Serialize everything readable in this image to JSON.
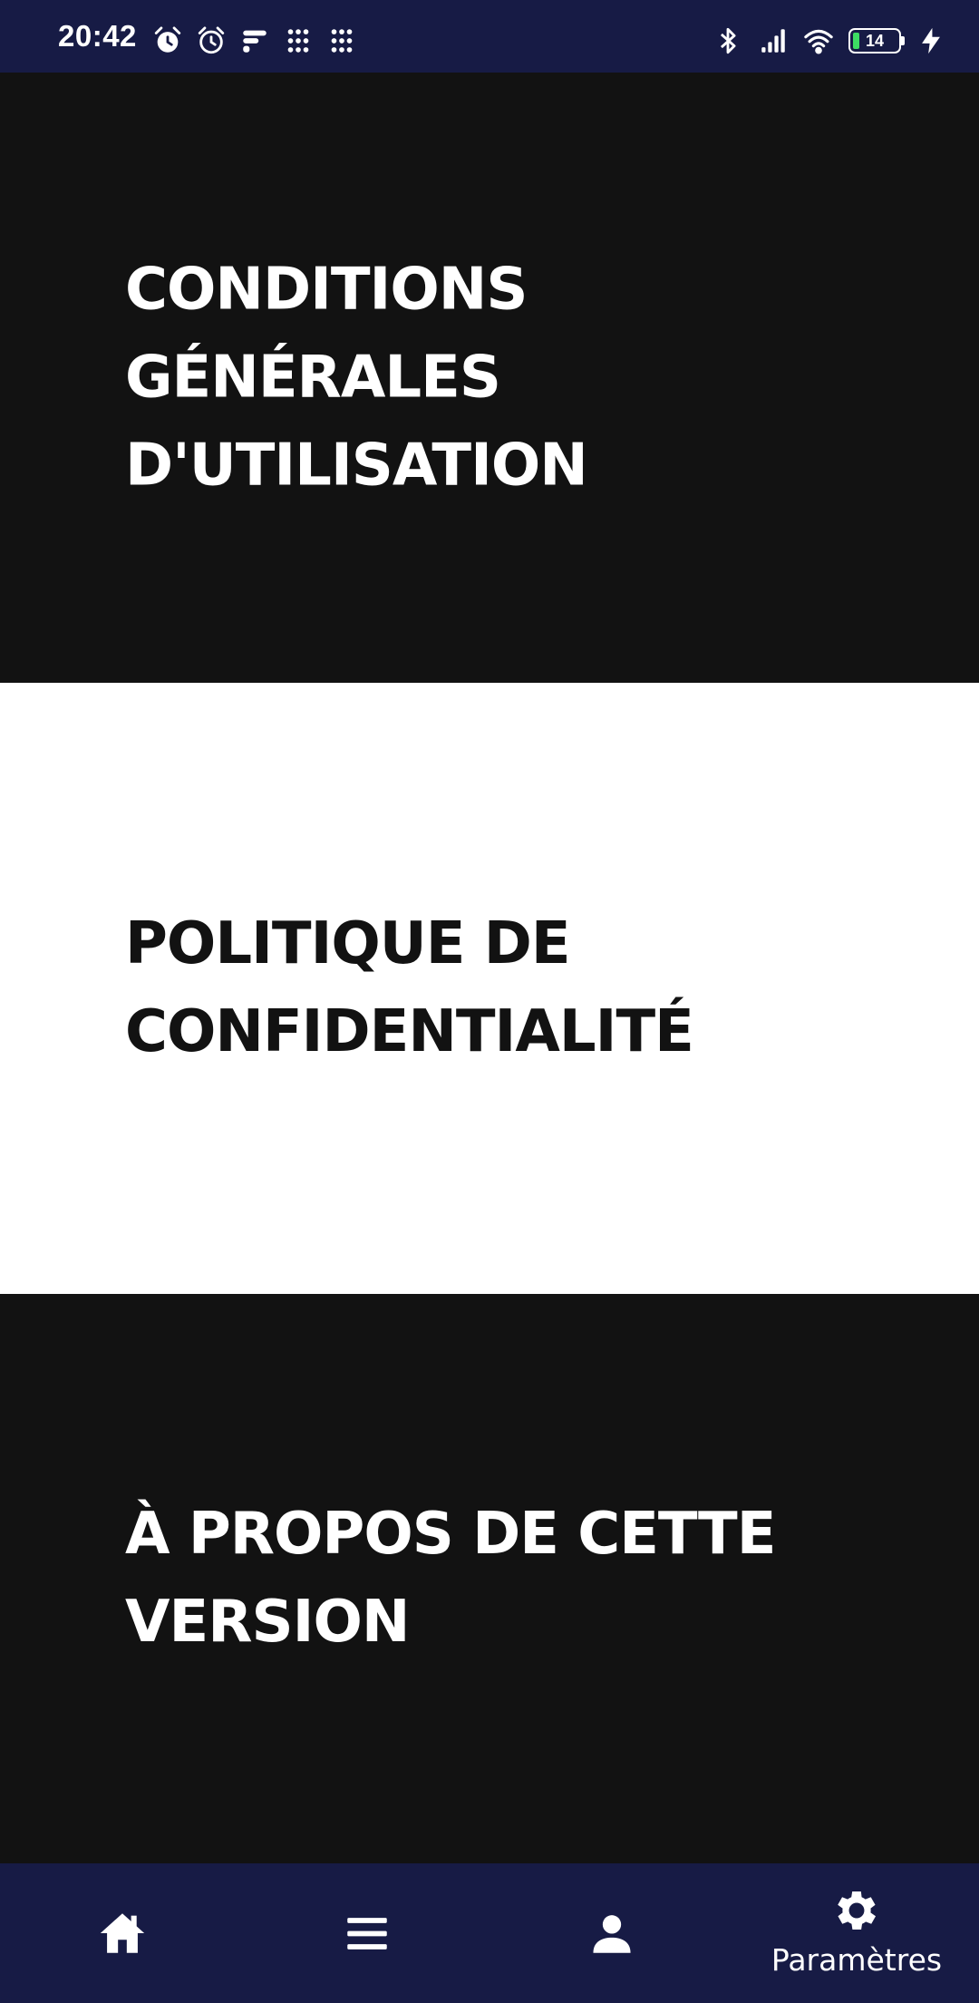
{
  "status_bar": {
    "time": "20:42",
    "battery_level": "14",
    "left_icons": [
      "alarm-icon",
      "alarm-clock-icon",
      "flash-app-icon",
      "grid-app-icon",
      "grid-app-icon"
    ],
    "right_icons": [
      "bluetooth-icon",
      "signal-icon",
      "wifi-icon",
      "battery-icon",
      "charging-icon"
    ],
    "background_color": "#171b45"
  },
  "panels": [
    {
      "title": "CONDITIONS GÉNÉRALES D'UTILISATION",
      "theme": "dark"
    },
    {
      "title": "POLITIQUE DE CONFIDENTIALITÉ",
      "theme": "light"
    },
    {
      "title": "À PROPOS DE CETTE VERSION",
      "theme": "dark"
    }
  ],
  "bottom_nav": {
    "background_color": "#171b45",
    "items": [
      {
        "icon": "home-icon",
        "label": ""
      },
      {
        "icon": "menu-icon",
        "label": ""
      },
      {
        "icon": "person-icon",
        "label": ""
      },
      {
        "icon": "gear-icon",
        "label": "Paramètres",
        "active": true
      }
    ]
  }
}
